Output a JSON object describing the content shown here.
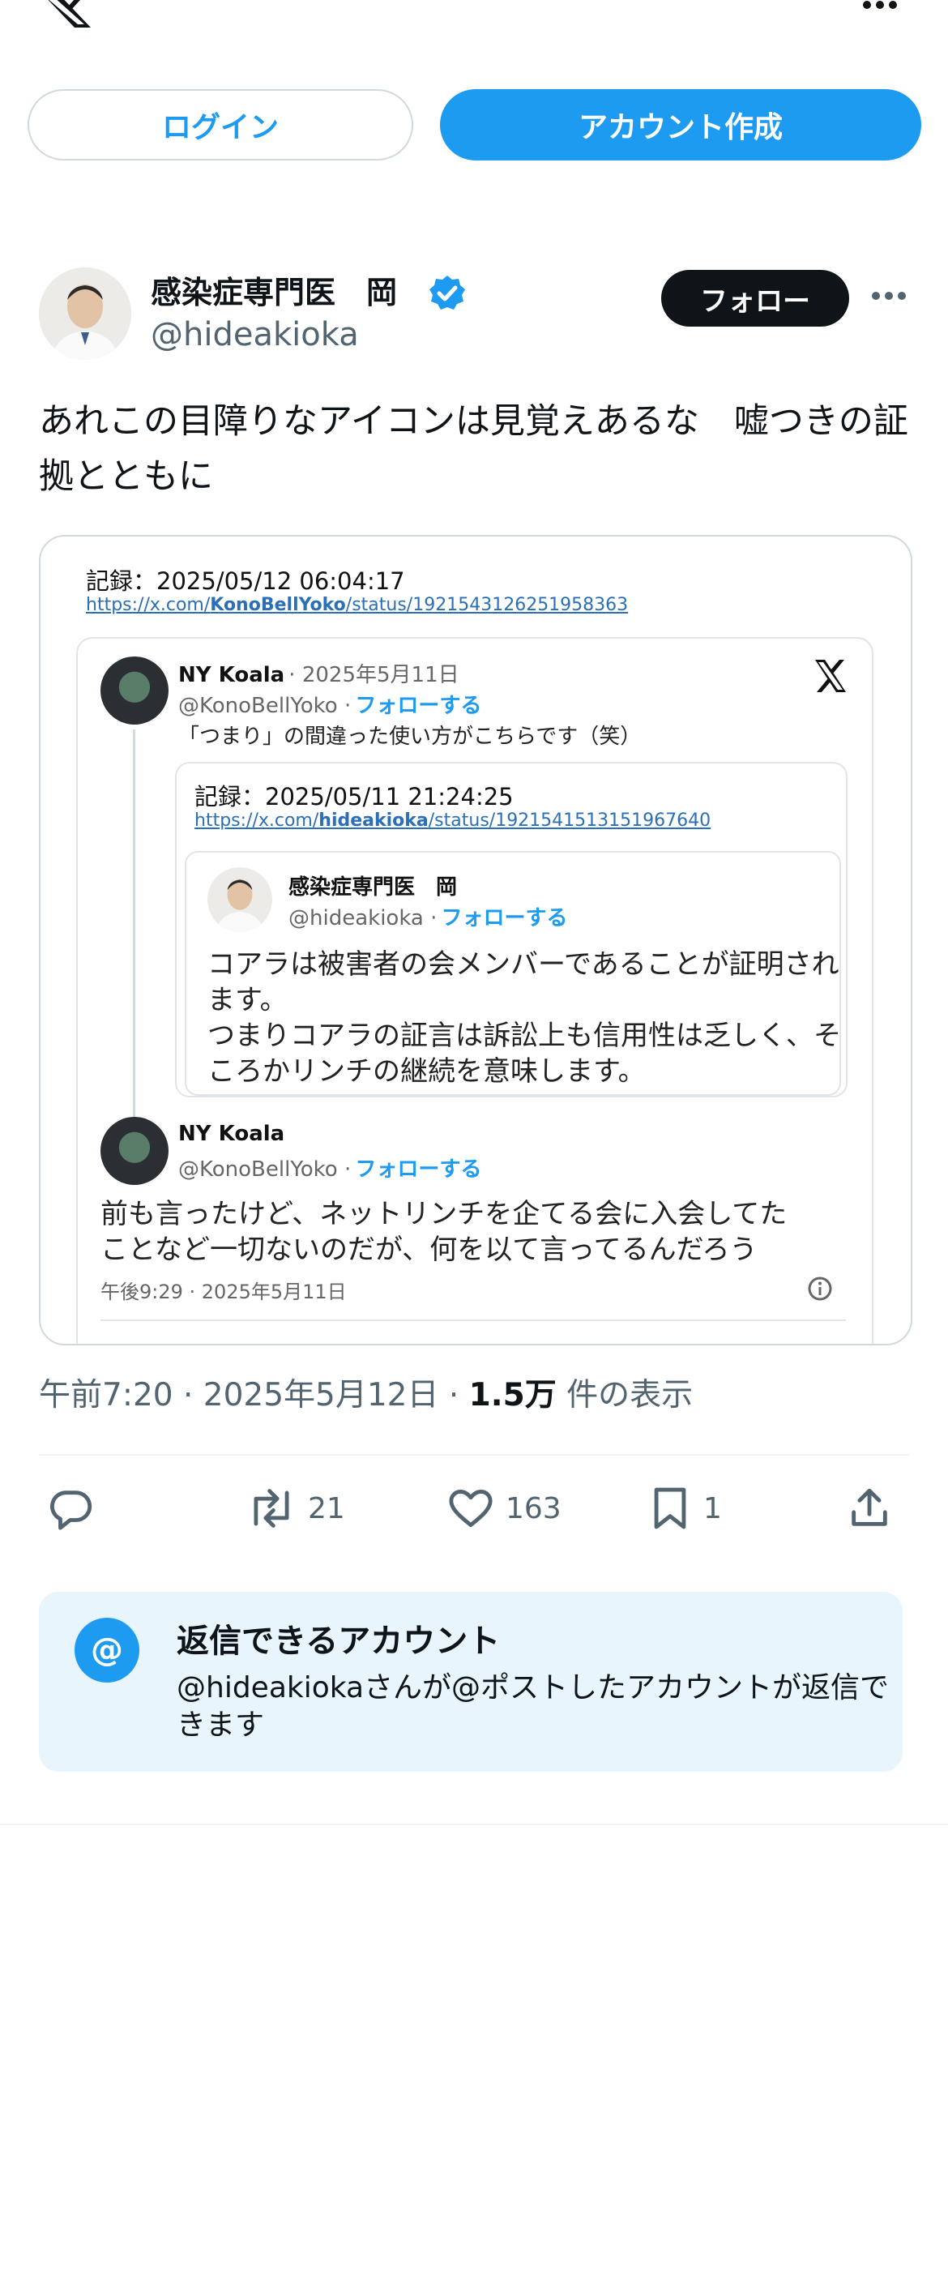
{
  "topbar": {
    "logo": "x-logo-icon",
    "more": "more-horizontal-icon"
  },
  "auth": {
    "login_label": "ログイン",
    "signup_label": "アカウント作成"
  },
  "author": {
    "name": "感染症専門医　岡",
    "handle": "@hideakioka",
    "follow_label": "フォロー"
  },
  "tweet": {
    "text": "あれこの目障りなアイコンは見覚えあるな　嘘つきの証拠とともに"
  },
  "media": {
    "record": "記録：2025/05/12 06:04:17",
    "url_prefix": "https://x.com/",
    "url_user": "KonoBellYoko",
    "url_suffix": "/status/1921543126251958363",
    "post1": {
      "name": "NY Koala",
      "date": "· 2025年5月11日",
      "handle": "@KonoBellYoko ·",
      "follow": "フォローする",
      "text": "「つまり」の間違った使い方がこちらです（笑）"
    },
    "nested": {
      "record": "記録：2025/05/11 21:24:25",
      "url_prefix": "https://x.com/",
      "url_user": "hideakioka",
      "url_suffix": "/status/1921541513151967640",
      "name": "感染症専門医　岡",
      "handle": "@hideakioka ·",
      "follow": "フォローする",
      "text1": "コアラは被害者の会メンバーであることが証明され",
      "text2": "ます。",
      "text3": "つまりコアラの証言は訴訟上も信用性は乏しく、そ",
      "text4": "ころかリンチの継続を意味します。"
    },
    "post2": {
      "name": "NY Koala",
      "handle": "@KonoBellYoko ·",
      "follow": "フォローする",
      "text1": "前も言ったけど、ネットリンチを企てる会に入会してた",
      "text2": "ことなど一切ないのだが、何を以て言ってるんだろう",
      "time": "午後9:29 · 2025年5月11日"
    }
  },
  "meta": {
    "time": "午前7:20 · 2025年5月12日 · ",
    "views": "1.5万",
    "views_label": " 件の表示"
  },
  "actions": {
    "reply": "",
    "retweet": "21",
    "like": "163",
    "bookmark": "1"
  },
  "reply_restriction": {
    "title": "返信できるアカウント",
    "desc": "@hideakiokaさんが@ポストしたアカウントが返信できます",
    "icon_text": "@"
  },
  "colors": {
    "accent": "#1d9bf0",
    "text": "#0f1419",
    "secondary": "#536471",
    "reply_bg": "#e8f5fd"
  }
}
